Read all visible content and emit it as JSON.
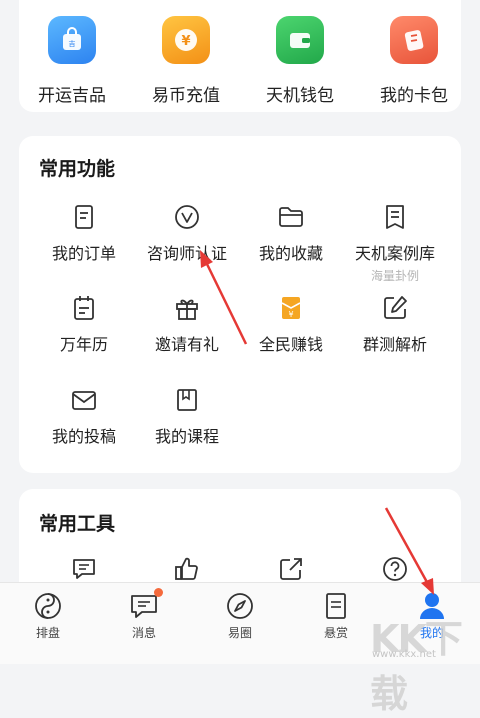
{
  "quick_actions": [
    {
      "label": "开运吉品",
      "icon": "bag-icon",
      "color": "#3b9cf5"
    },
    {
      "label": "易币充值",
      "icon": "yen-coin-icon",
      "color": "#f7a11c"
    },
    {
      "label": "天机钱包",
      "icon": "wallet-icon",
      "color": "#2fbf58"
    },
    {
      "label": "我的卡包",
      "icon": "ticket-icon",
      "color": "#f0664a"
    }
  ],
  "common_functions": {
    "title": "常用功能",
    "items": [
      {
        "label": "我的订单",
        "icon": "order-icon"
      },
      {
        "label": "咨询师认证",
        "icon": "verify-icon"
      },
      {
        "label": "我的收藏",
        "icon": "folder-icon"
      },
      {
        "label": "天机案例库",
        "sub": "海量卦例",
        "icon": "case-library-icon"
      },
      {
        "label": "万年历",
        "icon": "calendar-icon"
      },
      {
        "label": "邀请有礼",
        "icon": "gift-icon"
      },
      {
        "label": "全民赚钱",
        "icon": "earn-money-icon"
      },
      {
        "label": "群测解析",
        "icon": "edit-icon"
      },
      {
        "label": "我的投稿",
        "icon": "mail-icon"
      },
      {
        "label": "我的课程",
        "icon": "course-icon"
      }
    ]
  },
  "common_tools": {
    "title": "常用工具",
    "items": [
      {
        "icon": "message-icon"
      },
      {
        "icon": "thumbs-up-icon"
      },
      {
        "icon": "share-icon"
      },
      {
        "icon": "help-icon"
      }
    ]
  },
  "nav": {
    "items": [
      {
        "label": "排盘",
        "icon": "yin-yang-icon"
      },
      {
        "label": "消息",
        "icon": "message-icon",
        "badge": true
      },
      {
        "label": "易圈",
        "icon": "compass-icon"
      },
      {
        "label": "悬赏",
        "icon": "document-icon"
      },
      {
        "label": "我的",
        "icon": "user-icon",
        "active": true
      }
    ]
  },
  "watermark": {
    "logo": "KK下载",
    "url": "www.kkx.net"
  },
  "colors": {
    "accent": "#3b82f6",
    "annotation": "#e53935",
    "badge": "#f56a3c"
  }
}
